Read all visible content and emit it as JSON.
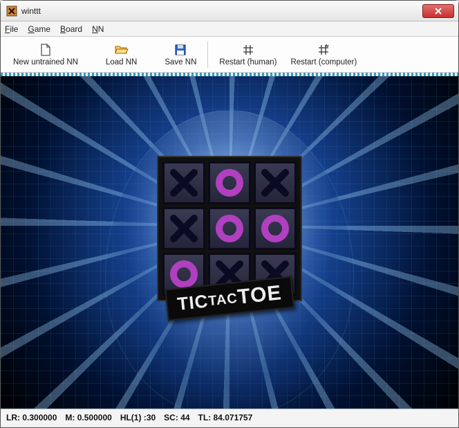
{
  "window": {
    "title": "winttt"
  },
  "menu": {
    "file": "File",
    "game": "Game",
    "board": "Board",
    "nn": "NN"
  },
  "toolbar": {
    "new_nn": "New untrained NN",
    "load_nn": "Load NN",
    "save_nn": "Save NN",
    "restart_human": "Restart (human)",
    "restart_computer": "Restart (computer)"
  },
  "board": {
    "cells": [
      "X",
      "O",
      "X",
      "X",
      "O",
      "O",
      "O",
      "X",
      "X"
    ]
  },
  "logo": {
    "text": "TICTACTOE"
  },
  "status": {
    "lr_label": "LR:",
    "lr_value": "0.300000",
    "m_label": "M:",
    "m_value": "0.500000",
    "hl_label": "HL(1) :",
    "hl_value": "30",
    "sc_label": "SC:",
    "sc_value": "44",
    "tl_label": "TL:",
    "tl_value": "84.071757"
  }
}
